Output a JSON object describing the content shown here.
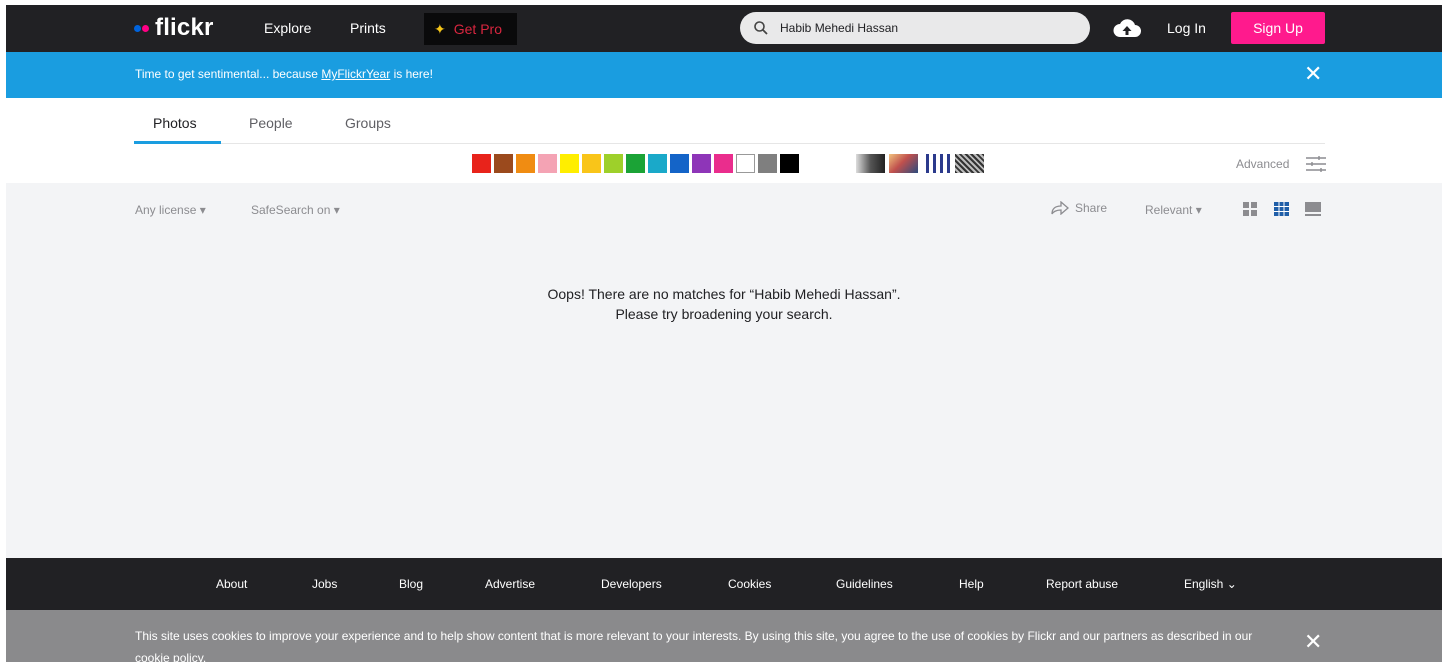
{
  "nav": {
    "brand": "flickr",
    "explore": "Explore",
    "prints": "Prints",
    "get_pro": "Get Pro",
    "search_value": "Habib Mehedi Hassan",
    "login": "Log In",
    "signup": "Sign Up"
  },
  "banner": {
    "text_before": "Time to get sentimental... because ",
    "link": "MyFlickrYear",
    "text_after": " is here!",
    "close": "✕"
  },
  "tabs": {
    "photos": "Photos",
    "people": "People",
    "groups": "Groups"
  },
  "color_swatches": [
    "#e8231b",
    "#9b4a1d",
    "#f08c12",
    "#f4a3b4",
    "#ffee00",
    "#f9c519",
    "#9ed02a",
    "#1ba336",
    "#1aa9c9",
    "#1464c8",
    "#8e35b8",
    "#ea2d8d",
    "#ffffff",
    "#7f7f7f",
    "#000000"
  ],
  "advanced": "Advanced",
  "filters": {
    "license": "Any license ▾",
    "safesearch": "SafeSearch on ▾",
    "share": "Share",
    "relevant": "Relevant ▾"
  },
  "empty_state": {
    "line1": "Oops! There are no matches for “Habib Mehedi Hassan”.",
    "line2": "Please try broadening your search."
  },
  "footer": {
    "about": "About",
    "jobs": "Jobs",
    "blog": "Blog",
    "advertise": "Advertise",
    "developers": "Developers",
    "cookies": "Cookies",
    "guidelines": "Guidelines",
    "help": "Help",
    "report_abuse": "Report abuse",
    "language": "English ⌄"
  },
  "cookie_notice": {
    "text": "This site uses cookies to improve your experience and to help show content that is more relevant to your interests. By using this site, you agree to the use of cookies by Flickr and our partners as described in our ",
    "link": "cookie policy",
    "text_end": ".",
    "close": "✕"
  }
}
